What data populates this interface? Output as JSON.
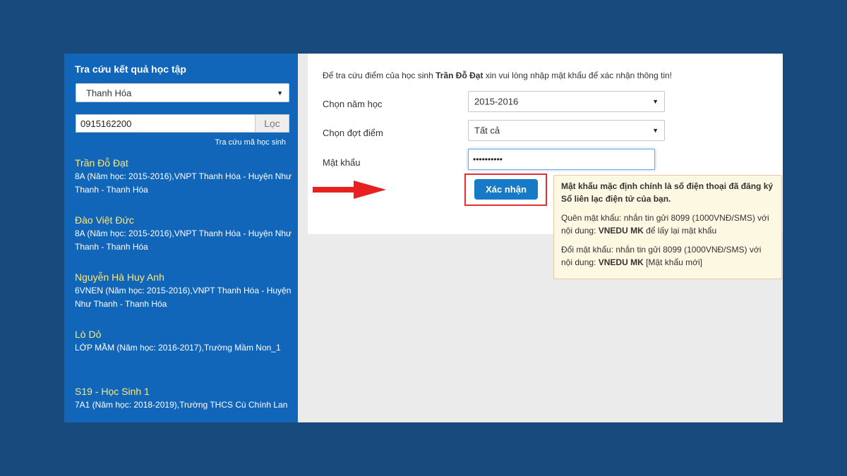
{
  "sidebar": {
    "title": "Tra cứu kết quả học tập",
    "province": "Thanh Hóa",
    "phone": "0915162200",
    "filter_label": "Lọc",
    "student_code_link": "Tra cứu mã học sinh",
    "students": [
      {
        "name": "Trần Đỗ Đạt",
        "info": "8A (Năm học: 2015-2016),VNPT Thanh Hóa - Huyện Như Thanh - Thanh Hóa"
      },
      {
        "name": "Đào Việt Đức",
        "info": "8A (Năm học: 2015-2016),VNPT Thanh Hóa - Huyện Như Thanh - Thanh Hóa"
      },
      {
        "name": "Nguyễn Hà Huy Anh",
        "info": "6VNEN (Năm học: 2015-2016),VNPT Thanh Hóa - Huyện Như Thanh - Thanh Hóa"
      },
      {
        "name": "Lò Dỏ",
        "info": "LỚP MẦM (Năm học: 2016-2017),Trường Mầm Non_1"
      },
      {
        "name": "S19 - Học Sinh 1",
        "info": "7A1 (Năm học: 2018-2019),Trường THCS Cù Chính Lan"
      }
    ]
  },
  "form": {
    "intro_prefix": "Để tra cứu điểm của học sinh",
    "intro_student": "Trần Đỗ Đạt",
    "intro_suffix": "xin vui lòng nhập mật khẩu để xác nhận thông tin!",
    "year_label": "Chọn năm học",
    "year_value": "2015-2016",
    "round_label": "Chọn đợt điểm",
    "round_value": "Tất cả",
    "password_label": "Mật khẩu",
    "password_value": "••••••••••",
    "confirm_label": "Xác nhận"
  },
  "help": {
    "line1": "Mật khẩu mặc định chính là số điện thoại đã đăng ký Sổ liên lạc điện tử của bạn.",
    "forgot_text": "Quên mật khẩu: nhắn tin gửi 8099 (1000VNĐ/SMS) với nội dung:",
    "forgot_code": "VNEDU MK",
    "forgot_suffix": "để lấy lại mật khẩu",
    "change_text": "Đổi mật khẩu: nhắn tin gửi 8099 (1000VNĐ/SMS) với nội dung:",
    "change_code": "VNEDU MK",
    "change_suffix": "[Mật khẩu mới]"
  },
  "icons": {
    "dropdown": "chevron-down-icon",
    "arrow": "red-right-arrow-icon"
  },
  "colors": {
    "background": "#184a7e",
    "sidebar": "#1266b9",
    "student_name": "#ffe974",
    "button": "#167ac6",
    "highlight": "#e53030"
  }
}
